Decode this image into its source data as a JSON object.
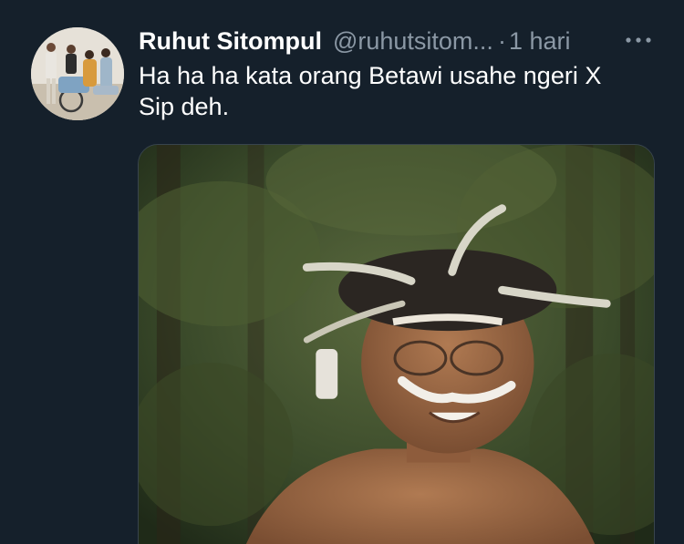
{
  "tweet": {
    "author_name": "Ruhut Sitompul",
    "author_handle": "@ruhutsitom...",
    "separator": "·",
    "timestamp": "1 hari",
    "more_icon": "more-horizontal-icon",
    "text_lines": [
      "Ha ha ha kata orang Betawi usahe ngeri X",
      "Sip deh."
    ]
  },
  "colors": {
    "background": "#15202b",
    "primary_text": "#ffffff",
    "secondary_text": "#8b98a5",
    "media_border": "#38444d"
  }
}
